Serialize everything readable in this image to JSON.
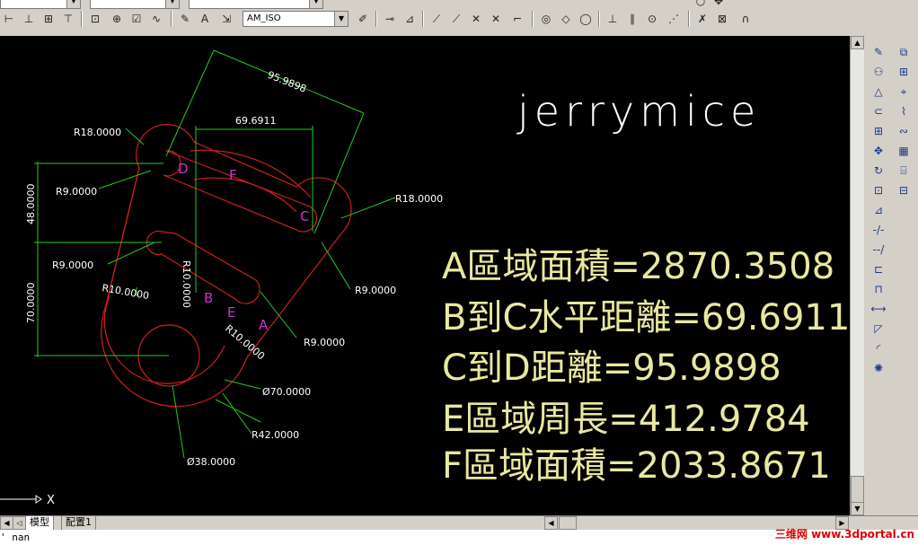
{
  "toolbar": {
    "dimstyle_combo": "AM_ISO"
  },
  "tabs": [
    {
      "label": "模型",
      "active": true
    },
    {
      "label": "配置1",
      "active": false
    }
  ],
  "command_line": "' nan",
  "watermark": "三维网 www.3dportal.cn",
  "drawing": {
    "title": "jerrymice",
    "results": [
      "A區域面積=2870.3508",
      "B到C水平距離=69.6911",
      "C到D距離=95.9898",
      "E區域周長=412.9784",
      "F區域面積=2033.8671"
    ],
    "dimensions": {
      "dim_95": "95.9898",
      "dim_69": "69.6911",
      "r18_top": "R18.0000",
      "r18_right": "R18.0000",
      "r9_left_top": "R9.0000",
      "r9_left_mid": "R9.0000",
      "r9_right": "R9.0000",
      "r9_bottom": "R9.0000",
      "r10_left": "R10.0000",
      "r10_vertical": "R10.0000",
      "r10_bottom": "R10.0000",
      "dim_48": "48.0000",
      "dim_70": "70.0000",
      "dia_70": "Ø70.0000",
      "r42": "R42.0000",
      "dia_38": "Ø38.0000"
    },
    "region_labels": [
      "A",
      "B",
      "C",
      "D",
      "E",
      "F"
    ],
    "ucs_x": "X"
  },
  "colors": {
    "background": "#000000",
    "geometry": "#cc2020",
    "dimension": "#22cc22",
    "dim_text": "#ffffff",
    "result_text": "#e8e8a0",
    "region_label": "#cc33cc"
  }
}
